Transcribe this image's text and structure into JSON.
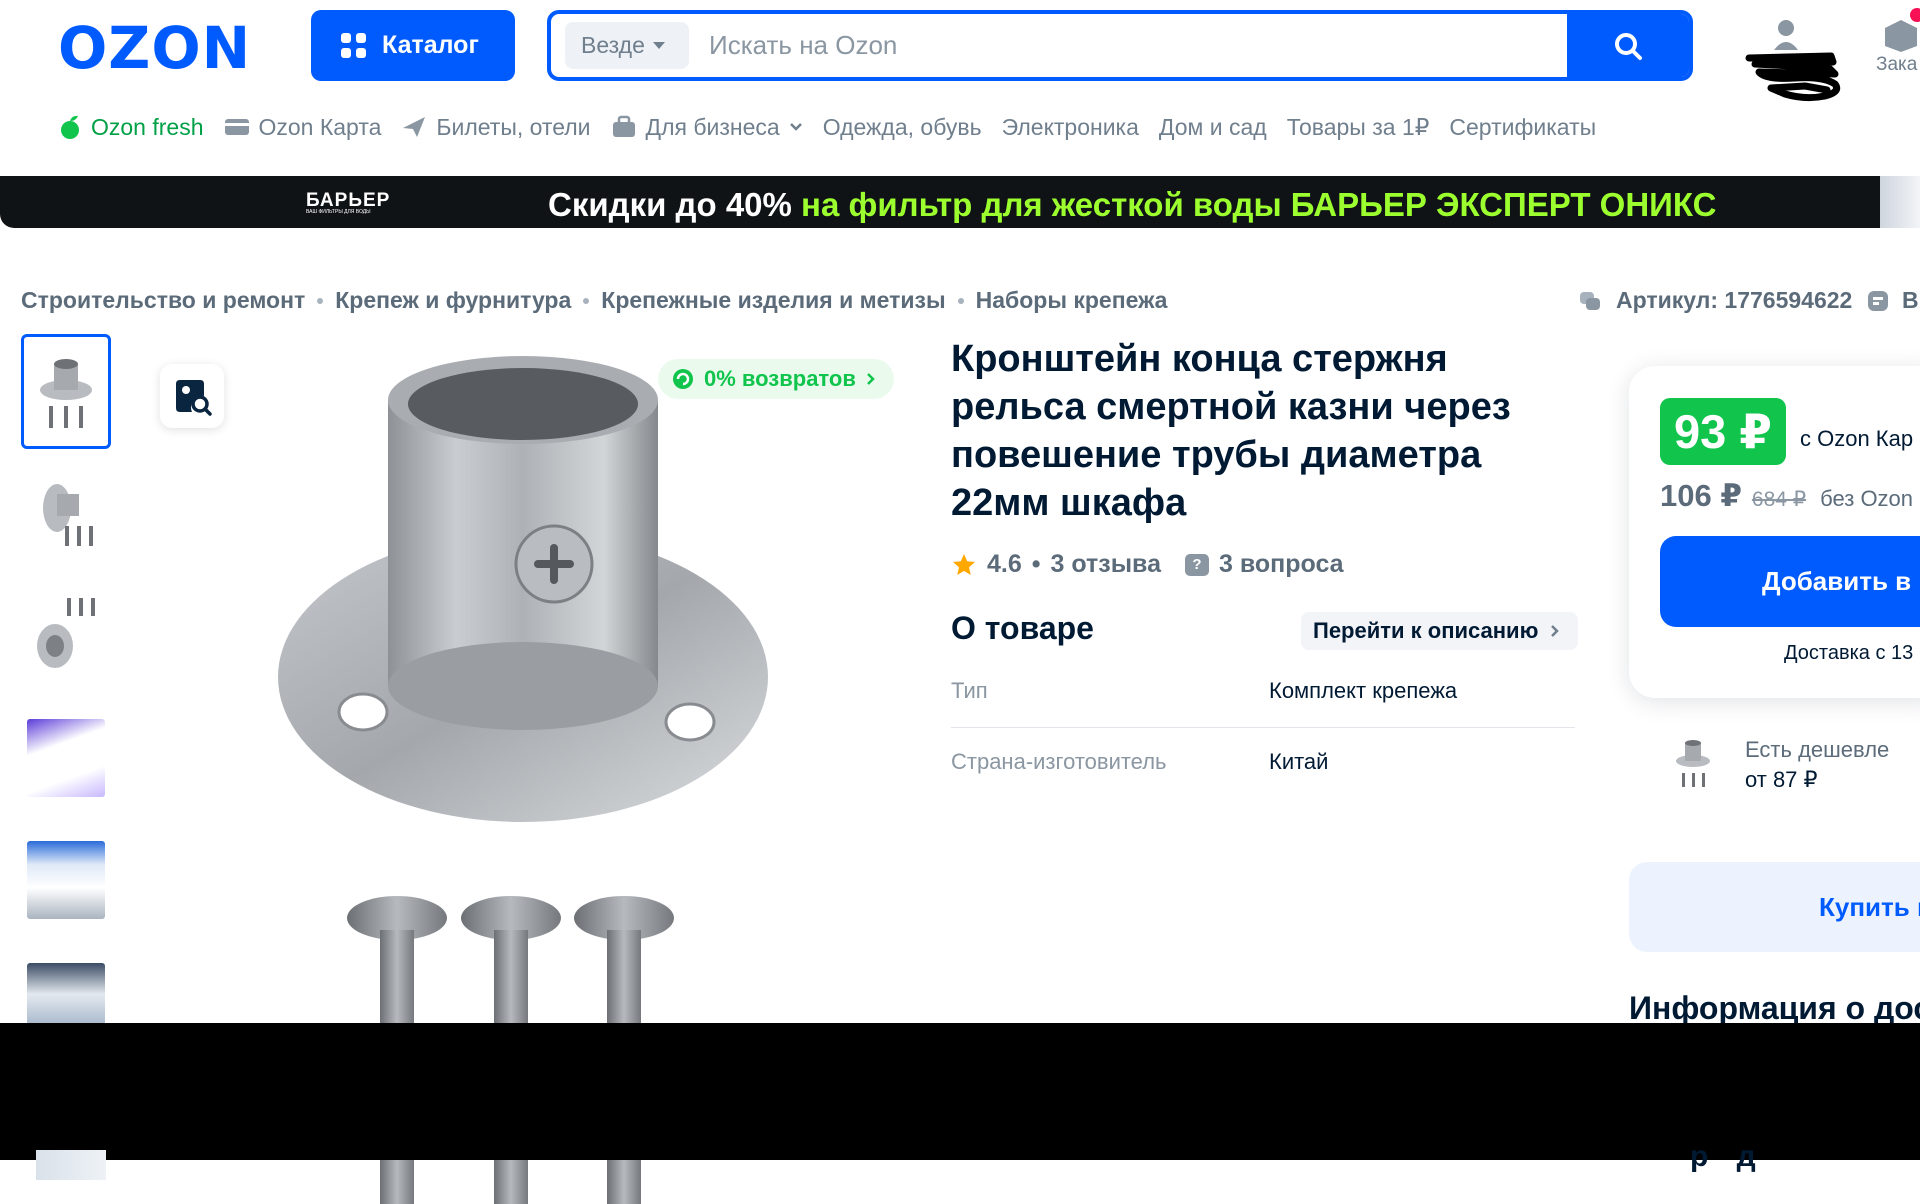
{
  "header": {
    "logo": "OZON",
    "catalog_label": "Каталог",
    "search_scope": "Везде",
    "search_placeholder": "Искать на Ozon",
    "orders_label": "Зака"
  },
  "nav": {
    "items": [
      {
        "label": "Ozon fresh",
        "icon": "fresh-icon"
      },
      {
        "label": "Ozon Карта",
        "icon": "card-icon"
      },
      {
        "label": "Билеты, отели",
        "icon": "plane-icon"
      },
      {
        "label": "Для бизнеса",
        "icon": "business-icon"
      },
      {
        "label": "Одежда, обувь"
      },
      {
        "label": "Электроника"
      },
      {
        "label": "Дом и сад"
      },
      {
        "label": "Товары за 1₽"
      },
      {
        "label": "Сертификаты"
      }
    ]
  },
  "banner": {
    "brand": "БАРЬЕР",
    "brand_sub": "ВАШ ФИЛЬТРЫ ДЛЯ ВОДЫ",
    "text_white": "Скидки до 40%",
    "text_green": " на фильтр для жесткой воды БАРЬЕР ЭКСПЕРТ ОНИКС"
  },
  "breadcrumb": [
    "Строительство и ремонт",
    "Крепеж и фурнитура",
    "Крепежные изделия и метизы",
    "Наборы крепежа"
  ],
  "article": {
    "text": "Артикул: 1776594622",
    "extra": "В"
  },
  "product": {
    "returns_badge": "0% возвратов",
    "title": "Кронштейн конца стержня рельса смертной казни через повешение трубы диаметра 22мм шкафа",
    "rating": "4.6",
    "reviews": "3 отзыва",
    "questions": "3 вопроса",
    "about_title": "О товаре",
    "goto_description": "Перейти к описанию",
    "specs": [
      {
        "key": "Тип",
        "value": "Комплект крепежа"
      },
      {
        "key": "Страна-изготовитель",
        "value": "Китай"
      }
    ]
  },
  "price": {
    "card_price": "93 ₽",
    "card_label": "с Ozon Кар",
    "regular_price": "106 ₽",
    "old_price": "684 ₽",
    "no_card_label": "без Ozon",
    "add_to_cart": "Добавить в к",
    "delivery": "Доставка с 13",
    "cheaper_line1": "Есть дешевле",
    "cheaper_line2": "от 87 ₽",
    "buy_now": "Купить в",
    "info_title": "Информация о дос",
    "below_text": "р д"
  },
  "colors": {
    "brand_blue": "#005bff",
    "green": "#10c44c",
    "banner_green": "#9cff2e",
    "text_dark": "#001a34",
    "text_muted": "#707f8d"
  }
}
